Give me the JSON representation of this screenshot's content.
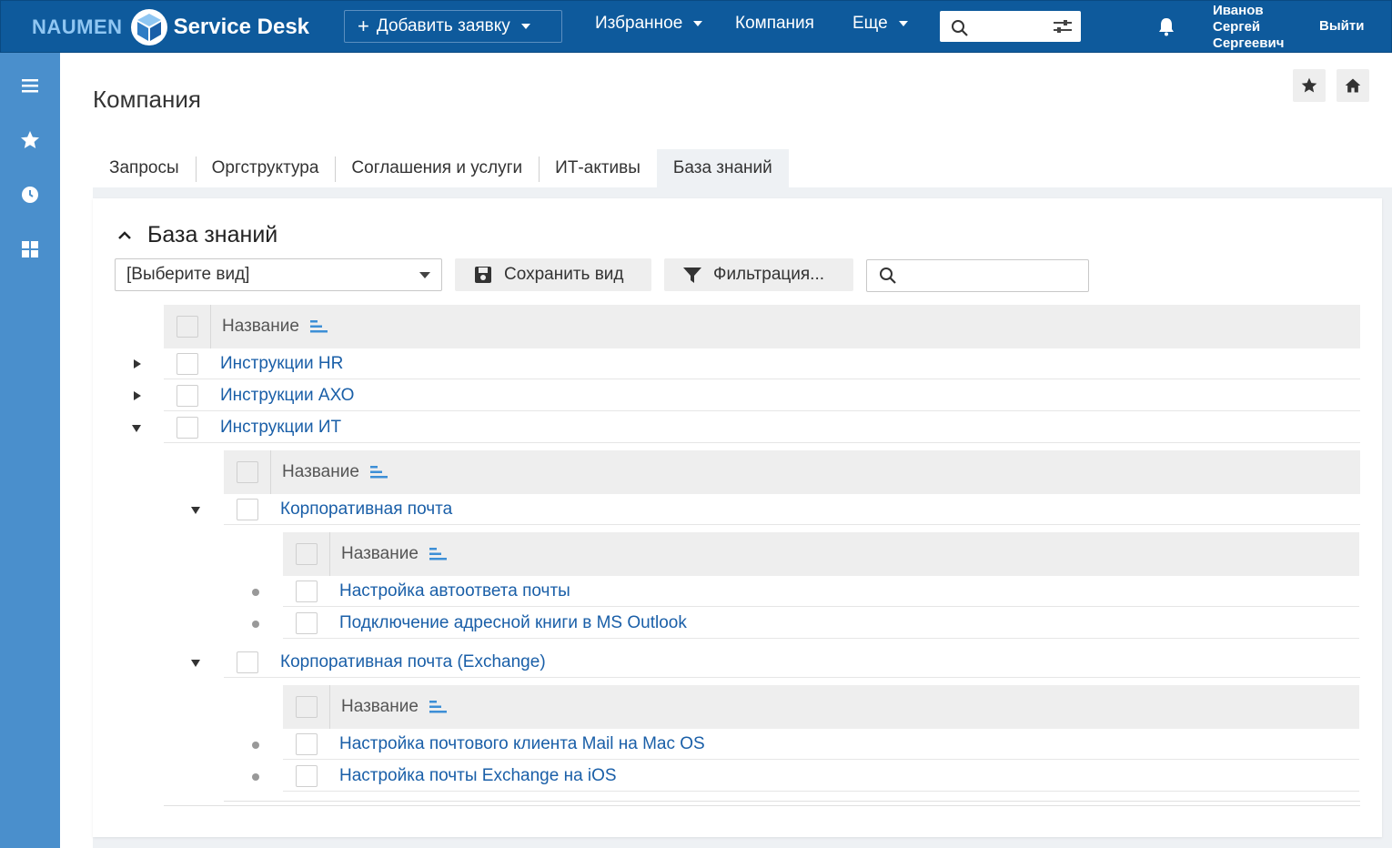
{
  "topbar": {
    "logo_left": "NAUMEN",
    "logo_right": "Service Desk",
    "add_button": "Добавить заявку",
    "add_plus": "+",
    "nav": {
      "favorites": "Избранное",
      "company": "Компания",
      "more": "Еще"
    },
    "user_name_line1": "Иванов",
    "user_name_line2": "Сергей",
    "user_name_line3": "Сергеевич",
    "logout": "Выйти"
  },
  "sidebar": {
    "icons": [
      "menu-icon",
      "star-icon",
      "clock-icon",
      "grid-icon"
    ]
  },
  "page": {
    "title": "Компания",
    "tabs": [
      {
        "label": "Запросы",
        "active": false
      },
      {
        "label": "Оргструктура",
        "active": false
      },
      {
        "label": "Соглашения и услуги",
        "active": false
      },
      {
        "label": "ИТ-активы",
        "active": false
      },
      {
        "label": "База знаний",
        "active": true
      }
    ]
  },
  "panel": {
    "title": "База знаний",
    "view_select": "[Выберите вид]",
    "save_view": "Сохранить вид",
    "filter": "Фильтрация...",
    "search_placeholder": ""
  },
  "tree": {
    "column_header": "Название",
    "top_items": [
      "Инструкции HR",
      "Инструкции АХО",
      "Инструкции ИТ"
    ],
    "it_children": [
      "Корпоративная почта",
      "Корпоративная почта (Exchange)"
    ],
    "mail_children": [
      "Настройка автоответа почты",
      "Подключение адресной книги в MS Outlook"
    ],
    "exchange_children": [
      "Настройка почтового клиента Mail на Mac OS",
      "Настройка почты Exchange на iOS"
    ]
  },
  "colors": {
    "topbar": "#0e5a9c",
    "sidebar": "#4a8fcc",
    "link": "#1a5fa8",
    "accent": "#3d8fd6"
  }
}
